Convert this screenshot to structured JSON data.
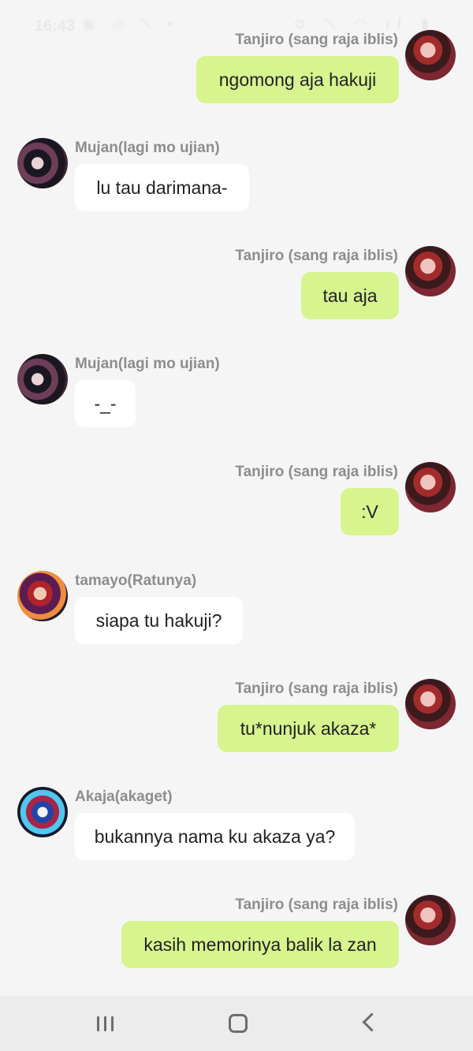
{
  "status_bar": {
    "time": "16:43",
    "left_icons": "▣ ◎ ⟍ •",
    "right_icons": "⊘ ⟍ ◠ ıl ▮"
  },
  "messages": [
    {
      "from": "Tanjiro (sang raja iblis)",
      "text": "ngomong aja hakuji",
      "side": "sent",
      "avatar": "tanjiro-avatar"
    },
    {
      "from": "Mujan(lagi mo ujian)",
      "text": "lu tau darimana-",
      "side": "recv",
      "avatar": "mujan-avatar"
    },
    {
      "from": "Tanjiro (sang raja iblis)",
      "text": "tau aja",
      "side": "sent",
      "avatar": "tanjiro-avatar"
    },
    {
      "from": "Mujan(lagi mo ujian)",
      "text": "-_-",
      "side": "recv",
      "avatar": "mujan-avatar"
    },
    {
      "from": "Tanjiro (sang raja iblis)",
      "text": ":V",
      "side": "sent",
      "avatar": "tanjiro-avatar"
    },
    {
      "from": "tamayo(Ratunya)",
      "text": "siapa tu hakuji?",
      "side": "recv",
      "avatar": "tamayo-avatar"
    },
    {
      "from": "Tanjiro (sang raja iblis)",
      "text": "tu*nunjuk akaza*",
      "side": "sent",
      "avatar": "tanjiro-avatar"
    },
    {
      "from": "Akaja(akaget)",
      "text": "bukannya nama ku akaza ya?",
      "side": "recv",
      "avatar": "akaja-avatar"
    },
    {
      "from": "Tanjiro (sang raja iblis)",
      "text": "kasih memorinya balik la zan",
      "side": "sent",
      "avatar": "tanjiro-avatar"
    }
  ],
  "colors": {
    "sent_bubble": "#d7f48e",
    "received_bubble": "#ffffff",
    "background": "#f5f5f5",
    "name_text": "#8d8d8d"
  },
  "nav_bar": {
    "icons": [
      "recent-apps-icon",
      "home-icon",
      "back-icon"
    ]
  }
}
